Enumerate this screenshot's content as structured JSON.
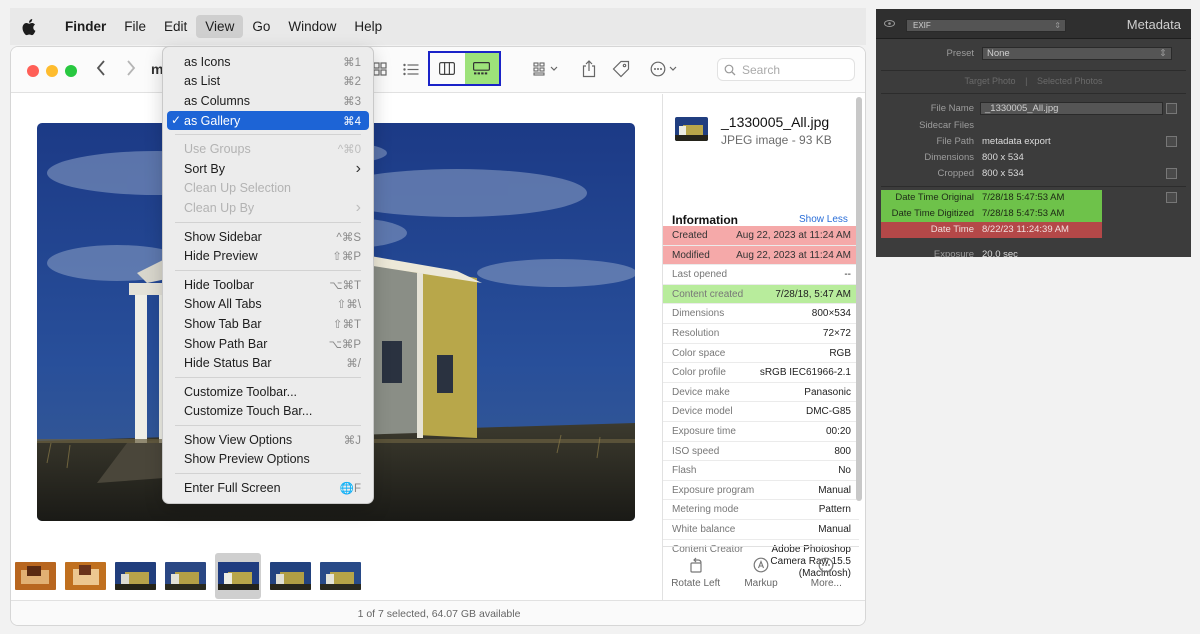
{
  "menubar": {
    "app": "Finder",
    "items": [
      "File",
      "Edit",
      "View",
      "Go",
      "Window",
      "Help"
    ]
  },
  "window": {
    "title_fragment": "m",
    "search_placeholder": "Search",
    "status": "1 of 7 selected, 64.07 GB available"
  },
  "view_menu": {
    "items": [
      {
        "label": "as Icons",
        "shortcut": "⌘1"
      },
      {
        "label": "as List",
        "shortcut": "⌘2"
      },
      {
        "label": "as Columns",
        "shortcut": "⌘3"
      },
      {
        "label": "as Gallery",
        "shortcut": "⌘4",
        "checked": true
      },
      {
        "label": "Use Groups",
        "shortcut": "^⌘0",
        "disabled": true
      },
      {
        "label": "Sort By",
        "shortcut": "›"
      },
      {
        "label": "Clean Up Selection",
        "shortcut": "",
        "disabled": true
      },
      {
        "label": "Clean Up By",
        "shortcut": "›",
        "disabled": true
      },
      {
        "label": "Show Sidebar",
        "shortcut": "^⌘S"
      },
      {
        "label": "Hide Preview",
        "shortcut": "⇧⌘P"
      },
      {
        "label": "Hide Toolbar",
        "shortcut": "⌥⌘T"
      },
      {
        "label": "Show All Tabs",
        "shortcut": "⇧⌘\\"
      },
      {
        "label": "Show Tab Bar",
        "shortcut": "⇧⌘T"
      },
      {
        "label": "Show Path Bar",
        "shortcut": "⌥⌘P"
      },
      {
        "label": "Hide Status Bar",
        "shortcut": "⌘/"
      },
      {
        "label": "Customize Toolbar...",
        "shortcut": ""
      },
      {
        "label": "Customize Touch Bar...",
        "shortcut": ""
      },
      {
        "label": "Show View Options",
        "shortcut": "⌘J"
      },
      {
        "label": "Show Preview Options",
        "shortcut": ""
      },
      {
        "label": "Enter Full Screen",
        "shortcut": "🌐F"
      }
    ]
  },
  "inspector": {
    "file_name": "_1330005_All.jpg",
    "file_type": "JPEG image - 93 KB",
    "info_title": "Information",
    "show_less": "Show Less",
    "rows": [
      {
        "k": "Created",
        "v": "Aug 22, 2023 at 11:24 AM",
        "hl": "red"
      },
      {
        "k": "Modified",
        "v": "Aug 22, 2023 at 11:24 AM",
        "hl": "red"
      },
      {
        "k": "Last opened",
        "v": "--"
      },
      {
        "k": "Content created",
        "v": "7/28/18, 5:47 AM",
        "hl": "green"
      },
      {
        "k": "Dimensions",
        "v": "800×534"
      },
      {
        "k": "Resolution",
        "v": "72×72"
      },
      {
        "k": "Color space",
        "v": "RGB"
      },
      {
        "k": "Color profile",
        "v": "sRGB IEC61966-2.1"
      },
      {
        "k": "Device make",
        "v": "Panasonic"
      },
      {
        "k": "Device model",
        "v": "DMC-G85"
      },
      {
        "k": "Exposure time",
        "v": "00:20"
      },
      {
        "k": "ISO speed",
        "v": "800"
      },
      {
        "k": "Flash",
        "v": "No"
      },
      {
        "k": "Exposure program",
        "v": "Manual"
      },
      {
        "k": "Metering mode",
        "v": "Pattern"
      },
      {
        "k": "White balance",
        "v": "Manual"
      },
      {
        "k": "Content Creator",
        "v": "Adobe Photoshop\nCamera Raw 15.5\n(Macintosh)",
        "tall": true
      }
    ],
    "actions": [
      "Rotate Left",
      "Markup",
      "More..."
    ]
  },
  "lightroom": {
    "title": "Metadata",
    "exif": "EXIF",
    "preset_label": "Preset",
    "preset_value": "None",
    "tab_target": "Target Photo",
    "tab_selected": "Selected Photos",
    "rows": {
      "file_name": {
        "k": "File Name",
        "v": "_1330005_All.jpg"
      },
      "sidecar": {
        "k": "Sidecar Files",
        "v": ""
      },
      "file_path": {
        "k": "File Path",
        "v": "metadata export"
      },
      "dimensions": {
        "k": "Dimensions",
        "v": "800 x 534"
      },
      "cropped": {
        "k": "Cropped",
        "v": "800 x 534"
      },
      "dt_original": {
        "k": "Date Time Original",
        "v": "7/28/18 5:47:53 AM"
      },
      "dt_digitized": {
        "k": "Date Time Digitized",
        "v": "7/28/18 5:47:53 AM"
      },
      "dt": {
        "k": "Date Time",
        "v": "8/22/23 11:24:39 AM"
      },
      "exposure": {
        "k": "Exposure",
        "v": "20.0 sec"
      }
    }
  },
  "colors": {
    "highlight_red": "#f5a9a9",
    "highlight_green": "#b8ec9c",
    "menu_selection": "#1d64d6",
    "view_group_border": "#1a23c8"
  }
}
